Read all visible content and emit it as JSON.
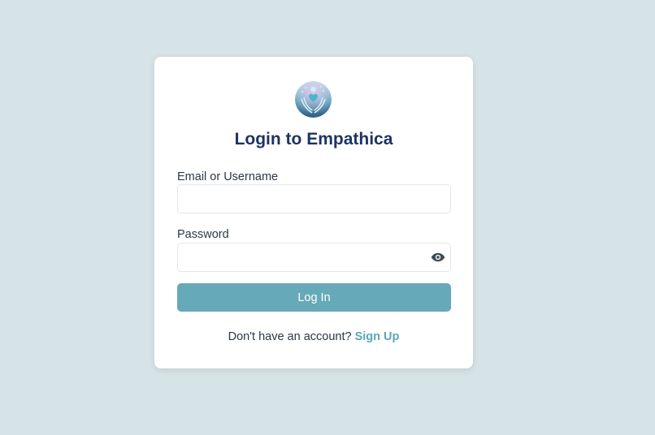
{
  "login": {
    "title": "Login to Empathica",
    "email_label": "Email or Username",
    "email_value": "",
    "email_placeholder": "",
    "password_label": "Password",
    "password_value": "",
    "password_placeholder": "",
    "password_toggle_icon": "eye-icon",
    "submit_label": "Log In",
    "signup_prompt": "Don't have an account?",
    "signup_link": "Sign Up"
  },
  "colors": {
    "background": "#d6e3e7",
    "title": "#1d3461",
    "button": "#66a9b8",
    "link": "#5ba5b7"
  },
  "logo": {
    "icon": "hands-heart-logo-icon"
  }
}
